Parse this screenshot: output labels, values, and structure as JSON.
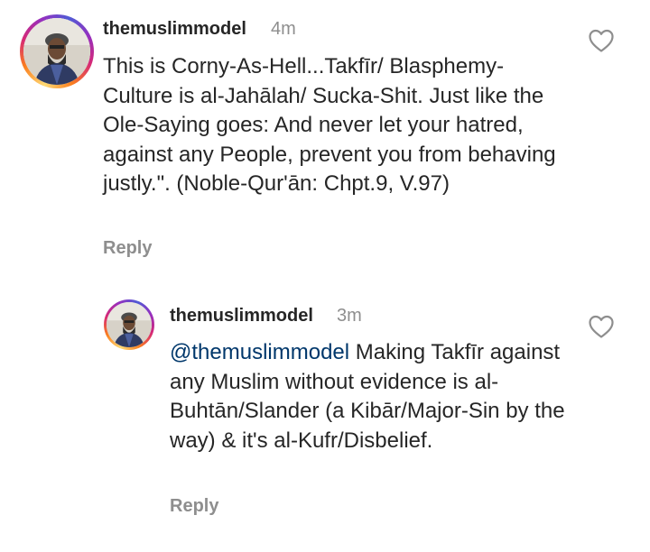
{
  "comments": [
    {
      "username": "themuslimmodel",
      "time": "4m",
      "text": "This is Corny-As-Hell...Takfīr/ Blasphemy-Culture is al-Jahālah/ Sucka-Shit. Just like the Ole-Saying goes: And never let your hatred, against any People, prevent you from behaving justly.\". (Noble-Qur'ān: Chpt.9, V.97)",
      "reply_label": "Reply",
      "like_icon": "heart-outline-icon"
    },
    {
      "username": "themuslimmodel",
      "time": "3m",
      "mention": "@themuslimmodel",
      "text": " Making Takfīr against any Muslim without evidence is al-Buhtān/Slander (a Kibār/Major-Sin by the way) & it's al-Kufr/Disbelief.",
      "reply_label": "Reply",
      "like_icon": "heart-outline-icon"
    }
  ],
  "colors": {
    "text": "#262626",
    "secondary": "#8e8e8e",
    "mention": "#00376b"
  }
}
